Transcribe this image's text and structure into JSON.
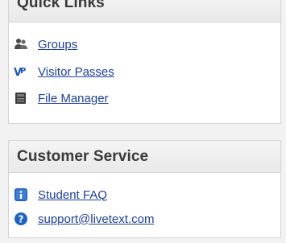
{
  "quick_links": {
    "title": "Quick Links",
    "items": [
      {
        "label": "Groups",
        "icon": "group-icon"
      },
      {
        "label": "Visitor Passes",
        "icon": "visitor-pass-icon"
      },
      {
        "label": "File Manager",
        "icon": "file-manager-icon"
      }
    ]
  },
  "customer_service": {
    "title": "Customer Service",
    "items": [
      {
        "label": "Student FAQ",
        "icon": "info-icon"
      },
      {
        "label": "support@livetext.com",
        "icon": "help-icon"
      }
    ]
  },
  "colors": {
    "link": "#1a3fa6",
    "header_text": "#3a3a3a",
    "info_blue": "#1f5fbf"
  }
}
